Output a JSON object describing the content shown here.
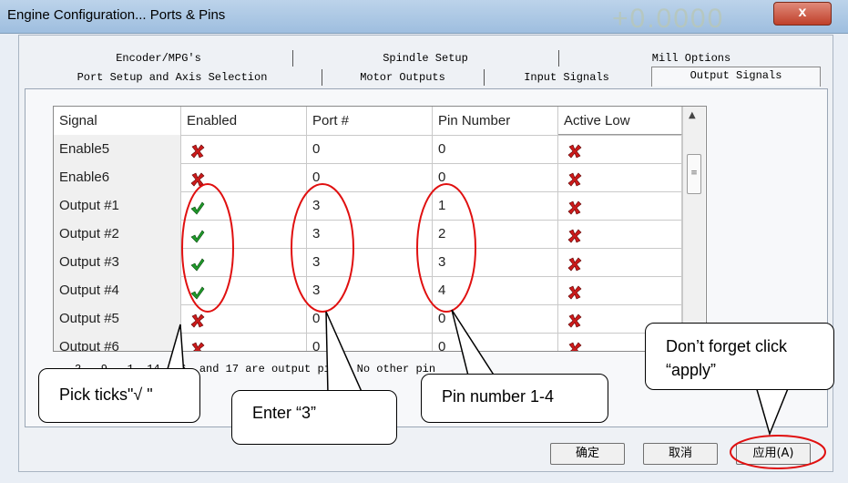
{
  "window": {
    "title": "Engine Configuration... Ports & Pins",
    "close_label": "x",
    "background_number": "+0.0000"
  },
  "tabs": {
    "row1": [
      "Encoder/MPG's",
      "Spindle Setup",
      "Mill Options"
    ],
    "row2": [
      "Port Setup and Axis Selection",
      "Motor Outputs",
      "Input Signals",
      "Output Signals"
    ],
    "active": "Output Signals"
  },
  "grid": {
    "headers": [
      "Signal",
      "Enabled",
      "Port #",
      "Pin Number",
      "Active Low"
    ],
    "rows": [
      {
        "signal": "Enable5",
        "enabled": "x",
        "port": "0",
        "pin": "0",
        "active_low": "x"
      },
      {
        "signal": "Enable6",
        "enabled": "x",
        "port": "0",
        "pin": "0",
        "active_low": "x"
      },
      {
        "signal": "Output #1",
        "enabled": "check",
        "port": "3",
        "pin": "1",
        "active_low": "x"
      },
      {
        "signal": "Output #2",
        "enabled": "check",
        "port": "3",
        "pin": "2",
        "active_low": "x"
      },
      {
        "signal": "Output #3",
        "enabled": "check",
        "port": "3",
        "pin": "3",
        "active_low": "x"
      },
      {
        "signal": "Output #4",
        "enabled": "check",
        "port": "3",
        "pin": "4",
        "active_low": "x"
      },
      {
        "signal": "Output #5",
        "enabled": "x",
        "port": "0",
        "pin": "0",
        "active_low": "x"
      },
      {
        "signal": "Output #6",
        "enabled": "x",
        "port": "0",
        "pin": "0",
        "active_low": "x"
      }
    ]
  },
  "note": "2 - 9 , 1, 14, 16, and 17 are output pins. No other pin",
  "buttons": {
    "ok": "确定",
    "cancel": "取消",
    "apply": "应用(A)"
  },
  "callouts": {
    "ticks": "Pick ticks\"√ \"",
    "port": "Enter “3”",
    "pin": "Pin number 1-4",
    "apply": "Don’t forget click “apply”"
  },
  "colors": {
    "x_icon": "#cc1b1b",
    "check_icon": "#1f9a2a",
    "annotation": "#e01010"
  }
}
